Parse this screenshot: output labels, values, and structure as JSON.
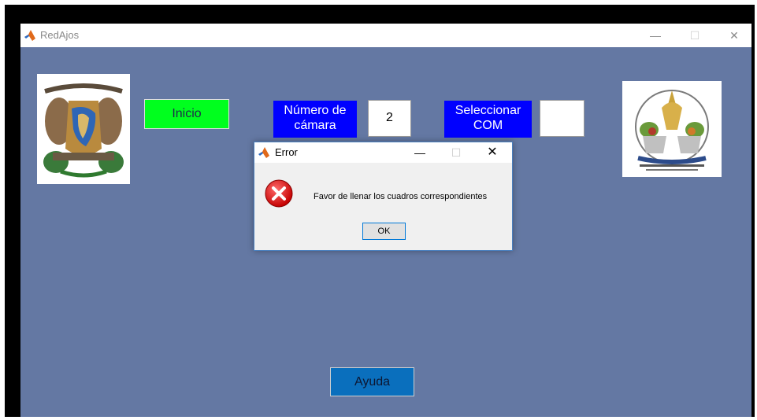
{
  "window": {
    "title": "RedAjos",
    "controls": {
      "minimize": "—",
      "maximize": "☐",
      "close": "✕"
    }
  },
  "main": {
    "start_button": "Inicio",
    "camera_label": "Número de cámara",
    "camera_value": "2",
    "com_label": "Seleccionar COM",
    "com_value": "",
    "help_button": "Ayuda",
    "logos": {
      "left": "unam-crest-logo",
      "right": "chapingo-university-logo"
    }
  },
  "dialog": {
    "title": "Error",
    "message": "Favor de llenar los cuadros correspondientes",
    "ok_button": "OK",
    "icon": "error-icon",
    "controls": {
      "minimize": "—",
      "maximize": "☐",
      "close": "✕"
    }
  },
  "colors": {
    "background": "#6478a3",
    "start_button": "#00ff1e",
    "label_blue": "#0000ff",
    "help_button": "#0a6fbd",
    "error_red": "#e81123"
  }
}
